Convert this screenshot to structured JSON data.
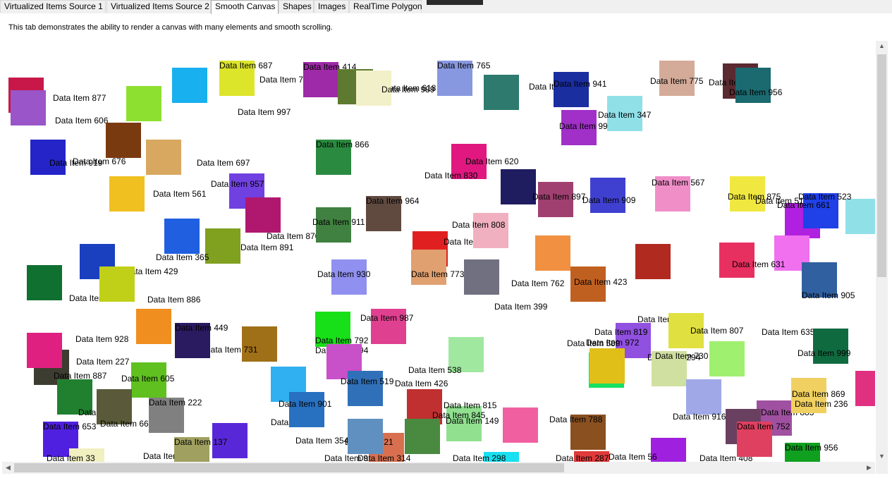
{
  "tabs": [
    {
      "label": "Virtualized Items Source 1",
      "active": false
    },
    {
      "label": "Virtualized Items Source 2",
      "active": false
    },
    {
      "label": "Smooth Canvas",
      "active": true
    },
    {
      "label": "Shapes",
      "active": false
    },
    {
      "label": "Images",
      "active": false
    },
    {
      "label": "RealTime Polygon",
      "active": false
    }
  ],
  "description": "This tab demonstrates the ability to render a canvas with many elements and smooth scrolling.",
  "canvas_items": [
    {
      "color": "#c8184a",
      "label": "Data Item 877"
    },
    {
      "color": "#9a55c8",
      "label": "Data Item 606"
    },
    {
      "color": "#18b0ee",
      "label": "Data Item 782"
    },
    {
      "color": "#dce52a",
      "label": "Data Item 687"
    },
    {
      "color": "#9e2aa8",
      "label": "Data Item 414"
    },
    {
      "color": "#5e7a30",
      "label": "Data Item 618"
    },
    {
      "color": "#f2f0c8",
      "label": "Data Item 989"
    },
    {
      "color": "#8898e0",
      "label": "Data Item 765"
    },
    {
      "color": "#2e7a6e",
      "label": "Data Item 587"
    },
    {
      "color": "#1a2ea0",
      "label": "Data Item 941"
    },
    {
      "color": "#8ee030",
      "label": "Data Item 997"
    },
    {
      "color": "#2424c8",
      "label": "Data Item 676"
    },
    {
      "color": "#7a3a10",
      "label": "Data Item 919"
    },
    {
      "color": "#d8a860",
      "label": "Data Item 697"
    },
    {
      "color": "#2a8a40",
      "label": "Data Item 866"
    },
    {
      "color": "#e01880",
      "label": "Data Item 830"
    },
    {
      "color": "#a030c8",
      "label": "Data Item 995"
    },
    {
      "color": "#90e0e8",
      "label": "Data Item 347"
    },
    {
      "color": "#d4aa98",
      "label": "Data Item 775"
    },
    {
      "color": "#5a2a30",
      "label": "Data Item 778"
    },
    {
      "color": "#1a6a70",
      "label": "Data Item 956"
    },
    {
      "color": "#f0c020",
      "label": "Data Item 561"
    },
    {
      "color": "#7040e0",
      "label": "Data Item 957"
    },
    {
      "color": "#b01870",
      "label": "Data Item 870"
    },
    {
      "color": "#80a020",
      "label": "Data Item 891"
    },
    {
      "color": "#2060e0",
      "label": "Data Item 365"
    },
    {
      "color": "#408040",
      "label": "Data Item 911"
    },
    {
      "color": "#604a40",
      "label": "Data Item 964"
    },
    {
      "color": "#e02020",
      "label": "Data Item 776"
    },
    {
      "color": "#f0b0c0",
      "label": "Data Item 808"
    },
    {
      "color": "#201c60",
      "label": "Data Item 620"
    },
    {
      "color": "#a04070",
      "label": "Data Item 897"
    },
    {
      "color": "#4040d0",
      "label": "Data Item 909"
    },
    {
      "color": "#f08ec8",
      "label": "Data Item 567"
    },
    {
      "color": "#f0e840",
      "label": "Data Item 875"
    },
    {
      "color": "#b020e0",
      "label": "Data Item 514"
    },
    {
      "color": "#2040e8",
      "label": "Data Item 661"
    },
    {
      "color": "#90e0e8",
      "label": "Data Item 523"
    },
    {
      "color": "#1a40c0",
      "label": "Data Item 429"
    },
    {
      "color": "#107030",
      "label": "Data Item 944"
    },
    {
      "color": "#c0d018",
      "label": "Data Item 886"
    },
    {
      "color": "#9090f0",
      "label": "Data Item 930"
    },
    {
      "color": "#e0a070",
      "label": "Data Item 773"
    },
    {
      "color": "#707080",
      "label": "Data Item 399"
    },
    {
      "color": "#f09040",
      "label": "Data Item 762"
    },
    {
      "color": "#c06020",
      "label": "Data Item 423"
    },
    {
      "color": "#b02a20",
      "label": "Data Item 153"
    },
    {
      "color": "#e83060",
      "label": "Data Item 635"
    },
    {
      "color": "#f070f0",
      "label": "Data Item 631"
    },
    {
      "color": "#3060a0",
      "label": "Data Item 905"
    },
    {
      "color": "#f08e20",
      "label": "Data Item 928"
    },
    {
      "color": "#18e018",
      "label": "Data Item 994"
    },
    {
      "color": "#e04090",
      "label": "Data Item 987"
    },
    {
      "color": "#9050e0",
      "label": "Data Item 819"
    },
    {
      "color": "#e0e040",
      "label": "Data Item 294"
    },
    {
      "color": "#a0f070",
      "label": "Data Item 807"
    },
    {
      "color": "#106a40",
      "label": "Data Item 999"
    },
    {
      "color": "#3c3c30",
      "label": "Data Item 887"
    },
    {
      "color": "#e02080",
      "label": "Data Item 227"
    },
    {
      "color": "#60c020",
      "label": "Data Item 605"
    },
    {
      "color": "#208030",
      "label": "Data Item 140"
    },
    {
      "color": "#5a5a3a",
      "label": "Data Item 667"
    },
    {
      "color": "#a07018",
      "label": "Data Item 731"
    },
    {
      "color": "#c850c8",
      "label": "Data Item 792"
    },
    {
      "color": "#3070b8",
      "label": "Data Item 519"
    },
    {
      "color": "#a0e8a0",
      "label": "Data Item 538"
    },
    {
      "color": "#18e060",
      "label": "Data Item 589"
    },
    {
      "color": "#d0e0a0",
      "label": "Data Item 730"
    },
    {
      "color": "#2a1a60",
      "label": "Data Item 449"
    },
    {
      "color": "#808080",
      "label": "Data Item 222"
    },
    {
      "color": "#5828d8",
      "label": "Data Item 594"
    },
    {
      "color": "#30b0f0",
      "label": "Data Item 530"
    },
    {
      "color": "#2870c0",
      "label": "Data Item 901"
    },
    {
      "color": "#90f0c8",
      "label": "Data Item 354"
    },
    {
      "color": "#c03030",
      "label": "Data Item 426"
    },
    {
      "color": "#90e090",
      "label": "Data Item 845"
    },
    {
      "color": "#f060a0",
      "label": "Data Item 815"
    },
    {
      "color": "#8a5020",
      "label": "Data Item 788"
    },
    {
      "color": "#a0a8e8",
      "label": "Data Item 916"
    },
    {
      "color": "#e0c018",
      "label": "Data Item 972"
    },
    {
      "color": "#a050a0",
      "label": "Data Item 883"
    },
    {
      "color": "#f0d060",
      "label": "Data Item 236"
    },
    {
      "color": "#e03080",
      "label": "Data Item 869"
    },
    {
      "color": "#5020e0",
      "label": "Data Item 653"
    },
    {
      "color": "#a0a060",
      "label": "Data Item 137"
    },
    {
      "color": "#e060c0",
      "label": "Data Item 910"
    },
    {
      "color": "#4a8a40",
      "label": "Data Item 149"
    },
    {
      "color": "#18e0f0",
      "label": "Data Item 298"
    },
    {
      "color": "#e03a3a",
      "label": "Data Item 287"
    },
    {
      "color": "#6a4060",
      "label": "Data Item 408"
    },
    {
      "color": "#10a020",
      "label": "Data Item 956"
    },
    {
      "color": "#d87050",
      "label": "Data Item 21"
    },
    {
      "color": "#a020e0",
      "label": "Data Item 56"
    },
    {
      "color": "#f0f0c0",
      "label": "Data Item 33"
    },
    {
      "color": "#6090c0",
      "label": "Data Item 314"
    },
    {
      "color": "#e04060",
      "label": "Data Item 752"
    }
  ]
}
